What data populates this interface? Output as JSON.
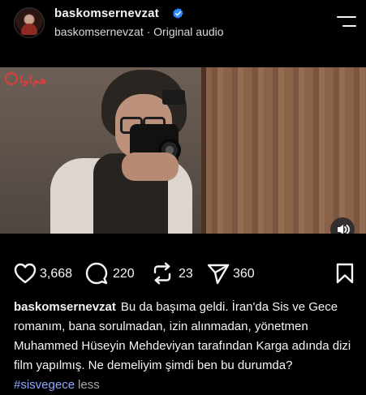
{
  "post": {
    "username": "baskomsernevzat",
    "subtitle": "baskomsernevzat · Original audio"
  },
  "media": {
    "watermark_text": "هم‌آوا"
  },
  "actions": {
    "likes": "3,668",
    "comments": "220",
    "reposts": "23",
    "shares": "360"
  },
  "caption": {
    "username": "baskomsernevzat",
    "text": "Bu da başıma geldi. İran'da Sis ve Gece romanım, bana sorulmadan, izin alınmadan, yönetmen Muhammed Hüseyin Mehdeviyan tarafından Karga adında dizi film yapılmış. Ne demeliyim şimdi ben bu durumda?",
    "hashtag": "#sisvegece",
    "less_label": "less"
  },
  "icons": {
    "verified": "verified-badge-icon",
    "menu": "menu-icon",
    "mute": "speaker-icon",
    "like": "heart-icon",
    "comment": "comment-icon",
    "repost": "repost-icon",
    "share": "share-icon",
    "save": "bookmark-icon"
  },
  "colors": {
    "background": "#000000",
    "verified": "#2f8cff",
    "hashtag": "#8ea9ff"
  }
}
